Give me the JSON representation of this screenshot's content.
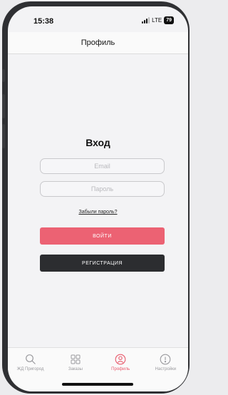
{
  "status": {
    "time": "15:38",
    "network": "LTE",
    "battery": "79"
  },
  "header": {
    "title": "Профиль"
  },
  "login": {
    "title": "Вход",
    "email_placeholder": "Email",
    "password_placeholder": "Пароль",
    "forgot_label": "Забыли пароль?",
    "login_button": "ВОЙТИ",
    "register_button": "РЕГИСТРАЦИЯ"
  },
  "tabbar": {
    "items": [
      {
        "label": "ЖД Пригород",
        "icon": "search-icon",
        "active": false
      },
      {
        "label": "Заказы",
        "icon": "grid-icon",
        "active": false
      },
      {
        "label": "Профиль",
        "icon": "profile-icon",
        "active": true
      },
      {
        "label": "Настройки",
        "icon": "info-icon",
        "active": false
      }
    ]
  },
  "colors": {
    "accent": "#ec6273",
    "active_tab": "#e85a6c",
    "dark_button": "#2c2d30"
  }
}
